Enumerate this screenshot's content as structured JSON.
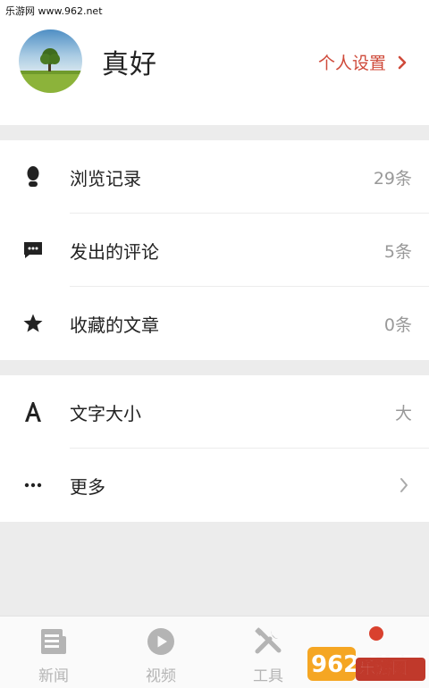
{
  "watermark": {
    "text": "乐游网 www.962.net"
  },
  "profile": {
    "username": "真好",
    "settings_label": "个人设置"
  },
  "list1": [
    {
      "icon": "footprint-icon",
      "label": "浏览记录",
      "value": "29条"
    },
    {
      "icon": "comment-icon",
      "label": "发出的评论",
      "value": "5条"
    },
    {
      "icon": "star-icon",
      "label": "收藏的文章",
      "value": "0条"
    }
  ],
  "list2": [
    {
      "icon": "font-size-icon",
      "label": "文字大小",
      "value": "大"
    },
    {
      "icon": "more-dots-icon",
      "label": "更多",
      "value": ""
    }
  ],
  "tabs": [
    {
      "icon": "news-icon",
      "label": "新闻"
    },
    {
      "icon": "video-play-icon",
      "label": "视频"
    },
    {
      "icon": "tools-icon",
      "label": "工具"
    }
  ],
  "logo": {
    "text": "962.NET",
    "subtext": "乐游网"
  },
  "colors": {
    "accent": "#cf4a3a",
    "muted": "#999999",
    "tab_gray": "#b4b4b4"
  }
}
